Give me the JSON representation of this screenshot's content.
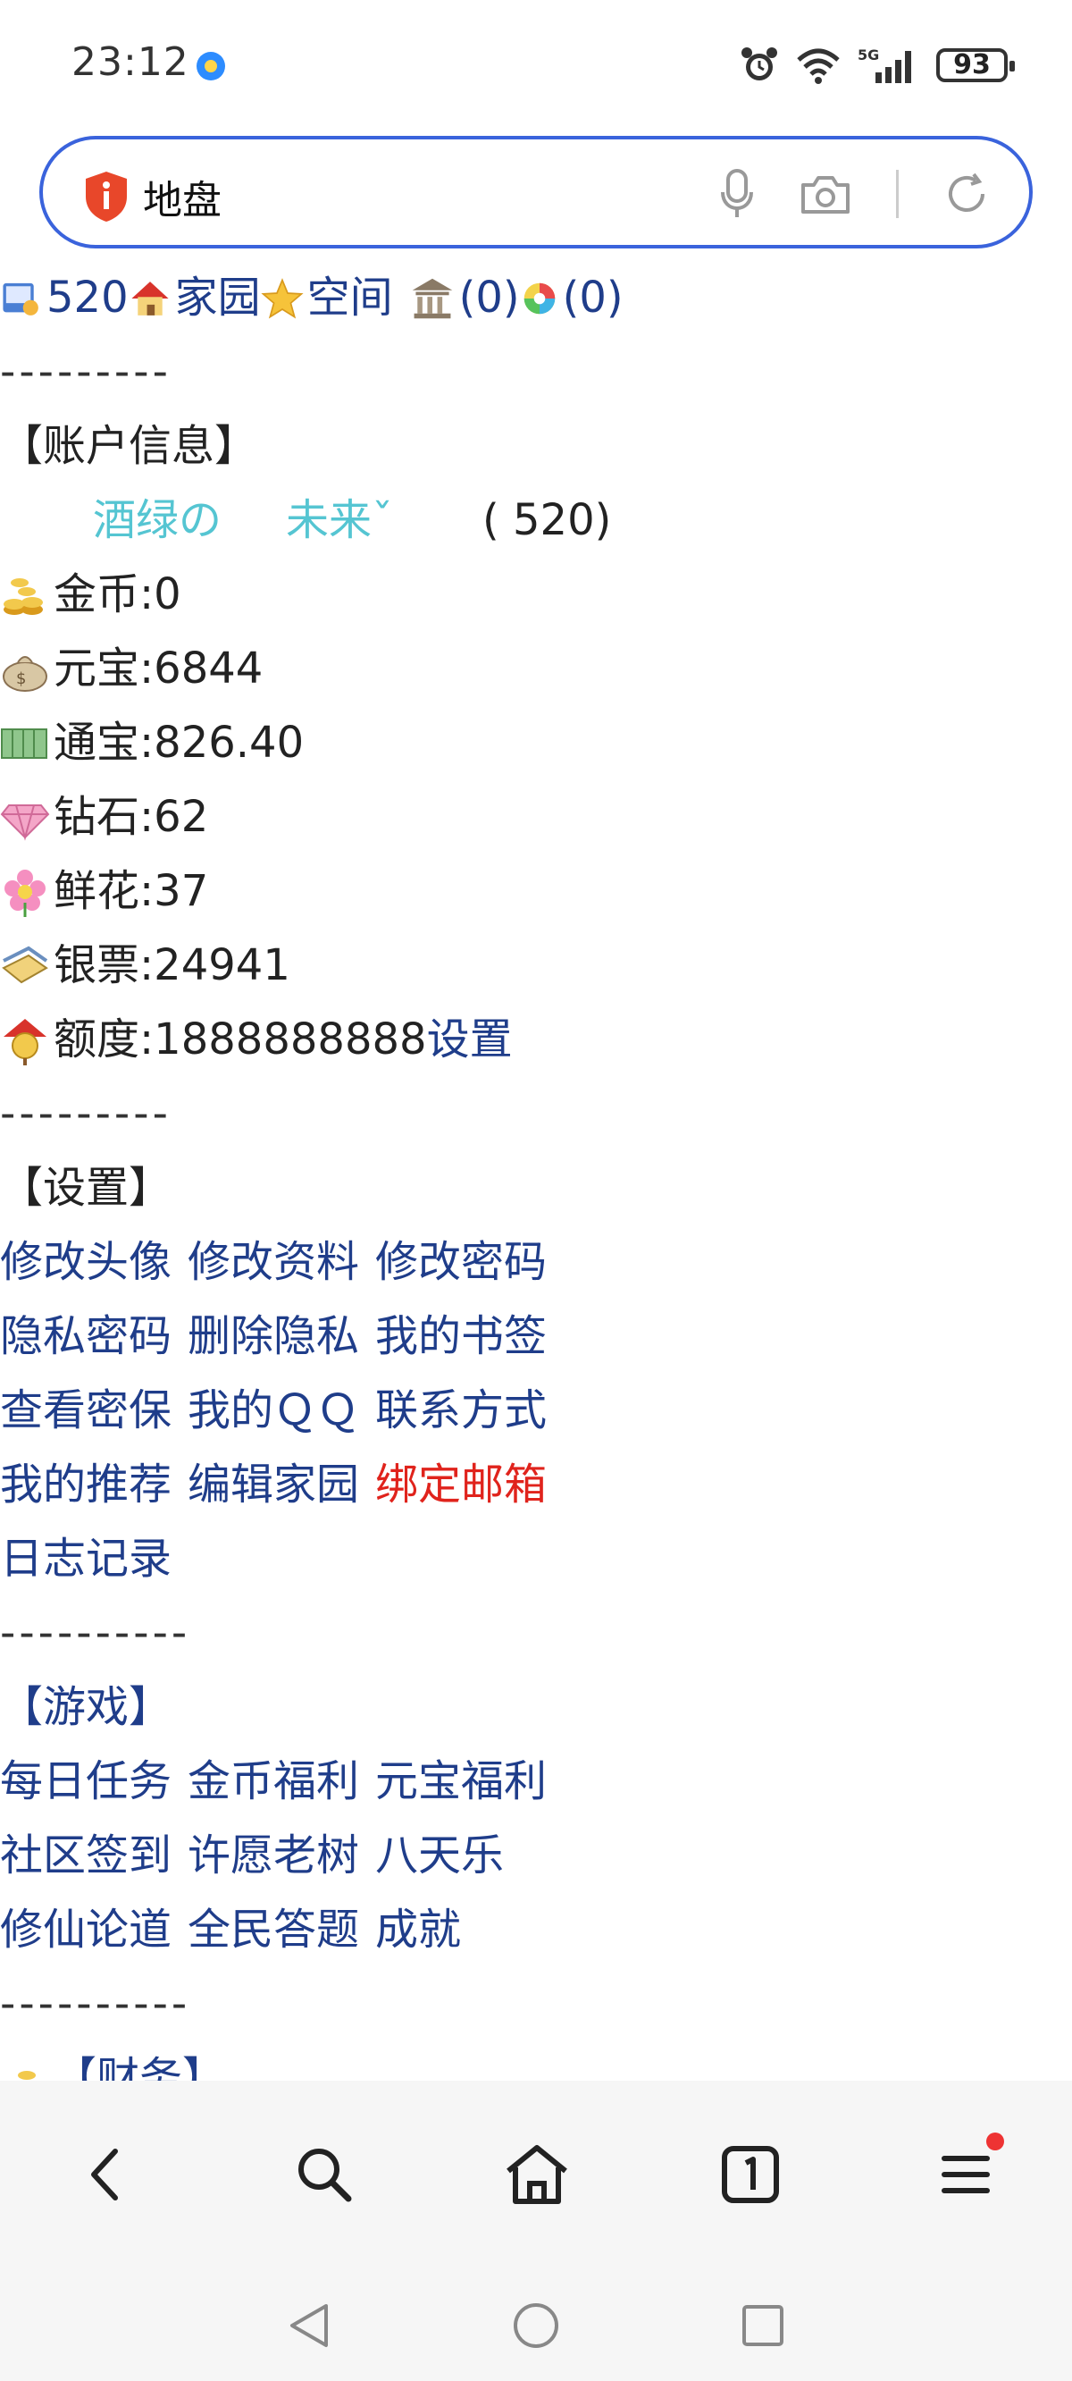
{
  "status_bar": {
    "time": "23:12",
    "network": "5G",
    "battery": "93"
  },
  "search_bar": {
    "query": "地盘"
  },
  "top_links": {
    "id": "520",
    "home": "家园",
    "space": "空间",
    "bank_count": "(0)",
    "color_count": "(0)"
  },
  "separators": {
    "s1": "---------",
    "s2": "---------",
    "s3": "----------",
    "s4": "----------"
  },
  "account": {
    "heading": "【账户信息】",
    "name_part1": "酒绿の",
    "name_part2": "未来ˇ",
    "user_id": "( 520)",
    "gold": "金币:0",
    "yuanbao": "元宝:6844",
    "tongbao": "通宝:826.40",
    "diamond": "钻石:62",
    "flower": "鲜花:37",
    "banknote": "银票:24941",
    "quota": "额度:1888888888",
    "quota_setting": "设置"
  },
  "settings": {
    "heading": "【设置】",
    "links": [
      [
        "修改头像",
        "修改资料",
        "修改密码"
      ],
      [
        "隐私密码",
        "删除隐私",
        "我的书签"
      ],
      [
        "查看密保",
        "我的ＱＱ",
        "联系方式"
      ],
      [
        "我的推荐",
        "编辑家园",
        "绑定邮箱"
      ],
      [
        "日志记录"
      ]
    ]
  },
  "games": {
    "heading": "【游戏】",
    "links": [
      [
        "每日任务",
        "金币福利",
        "元宝福利"
      ],
      [
        "社区签到",
        "许愿老树",
        "八天乐"
      ],
      [
        "修仙论道",
        "全民答题",
        "成就"
      ]
    ]
  },
  "finance": {
    "heading": "【财务】"
  },
  "colors": {
    "link": "#1f3d8a",
    "highlight": "#e0231c",
    "search_border": "#3a63dc",
    "name_teal": "#55c5d2"
  }
}
